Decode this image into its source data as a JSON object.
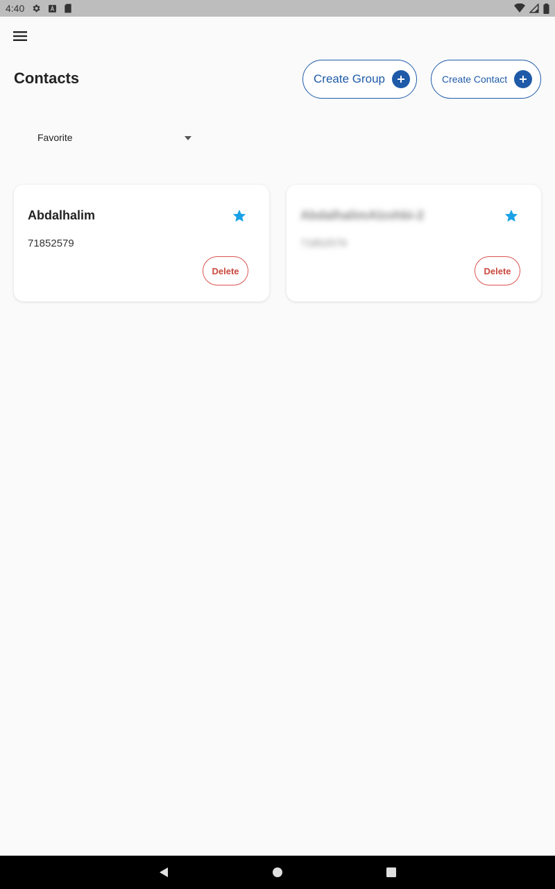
{
  "status_bar": {
    "time": "4:40",
    "left_icons": [
      "settings-icon",
      "a-badge-icon",
      "sd-card-icon"
    ],
    "right_icons": [
      "wifi-icon",
      "signal-icon",
      "battery-icon"
    ]
  },
  "header": {
    "menu_icon": "hamburger-menu-icon",
    "title": "Contacts",
    "create_group_label": "Create Group",
    "create_contact_label": "Create Contact"
  },
  "filter": {
    "selected": "Favorite"
  },
  "contacts": [
    {
      "name": "Abdalhalim",
      "phone": "71852579",
      "favorite": true,
      "delete_label": "Delete"
    },
    {
      "name": "AbdalhalimAlzohbi-2",
      "phone": "71852579",
      "favorite": true,
      "delete_label": "Delete"
    }
  ],
  "colors": {
    "accent": "#1e5aa8",
    "star": "#1aa1e6",
    "delete": "#c9483f",
    "background": "#fafafa"
  },
  "nav_bar": {
    "icons": [
      "back-icon",
      "home-icon",
      "recents-icon"
    ]
  }
}
